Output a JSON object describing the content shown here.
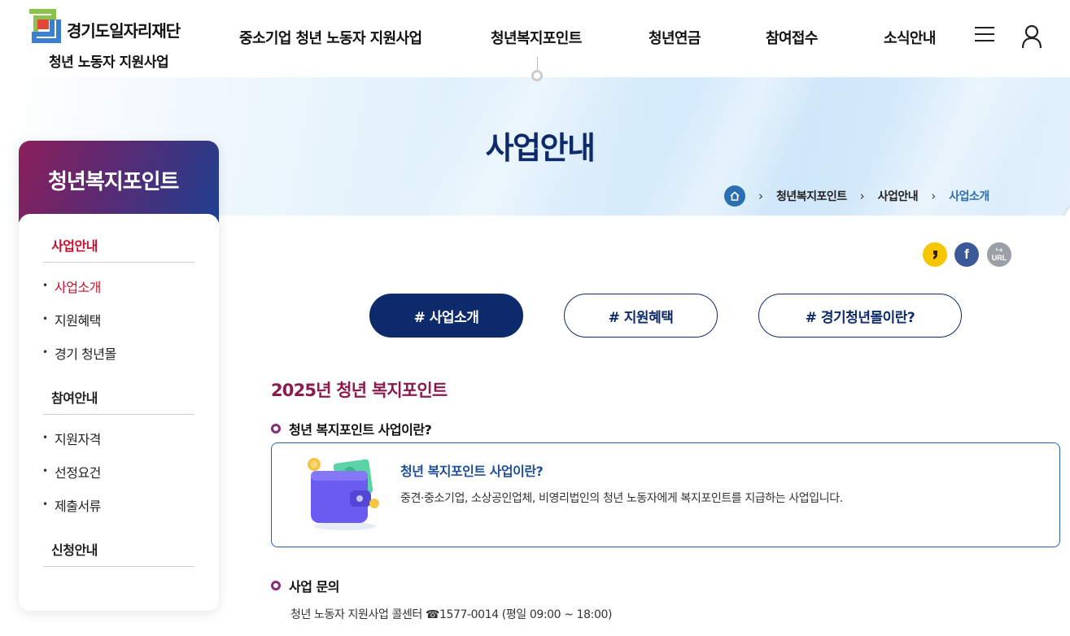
{
  "header": {
    "logo_text": "경기도일자리재단",
    "logo_sub": "청년 노동자 지원사업",
    "nav": [
      "중소기업 청년 노동자 지원사업",
      "청년복지포인트",
      "청년연금",
      "참여접수",
      "소식안내"
    ],
    "icons": [
      "hamburger-menu-icon",
      "user-icon"
    ]
  },
  "banner": {
    "title": "사업안내",
    "breadcrumb": [
      "청년복지포인트",
      "사업안내",
      "사업소개"
    ]
  },
  "sidebar": {
    "title": "청년복지포인트",
    "groups": [
      {
        "label": "사업안내",
        "items": [
          "사업소개",
          "지원혜택",
          "경기 청년몰"
        ]
      },
      {
        "label": "참여안내",
        "items": [
          "지원자격",
          "선정요건",
          "제출서류"
        ]
      },
      {
        "label": "신청안내",
        "items": []
      }
    ]
  },
  "share": {
    "kakao": "kakao-share-icon",
    "facebook": "f",
    "url": "URL"
  },
  "tabs": [
    "# 사업소개",
    "# 지원혜택",
    "# 경기청년몰이란?"
  ],
  "content": {
    "section_title": "2025년 청년 복지포인트",
    "sub1": "청년 복지포인트 사업이란?",
    "card_title": "청년 복지포인트 사업이란?",
    "card_desc": "중견·중소기업, 소상공인업체, 비영리법인의 청년 노동자에게 복지포인트를 지급하는 사업입니다.",
    "sub2": "사업 문의",
    "contact": "청년 노동자 지원사업 콜센터 ☎1577-0014 (평일 09:00 ~ 18:00)"
  },
  "colors": {
    "navy": "#0d2a6b",
    "accent_red": "#c8102e",
    "plum": "#8b1a4e",
    "link_blue": "#2b6fb2"
  }
}
